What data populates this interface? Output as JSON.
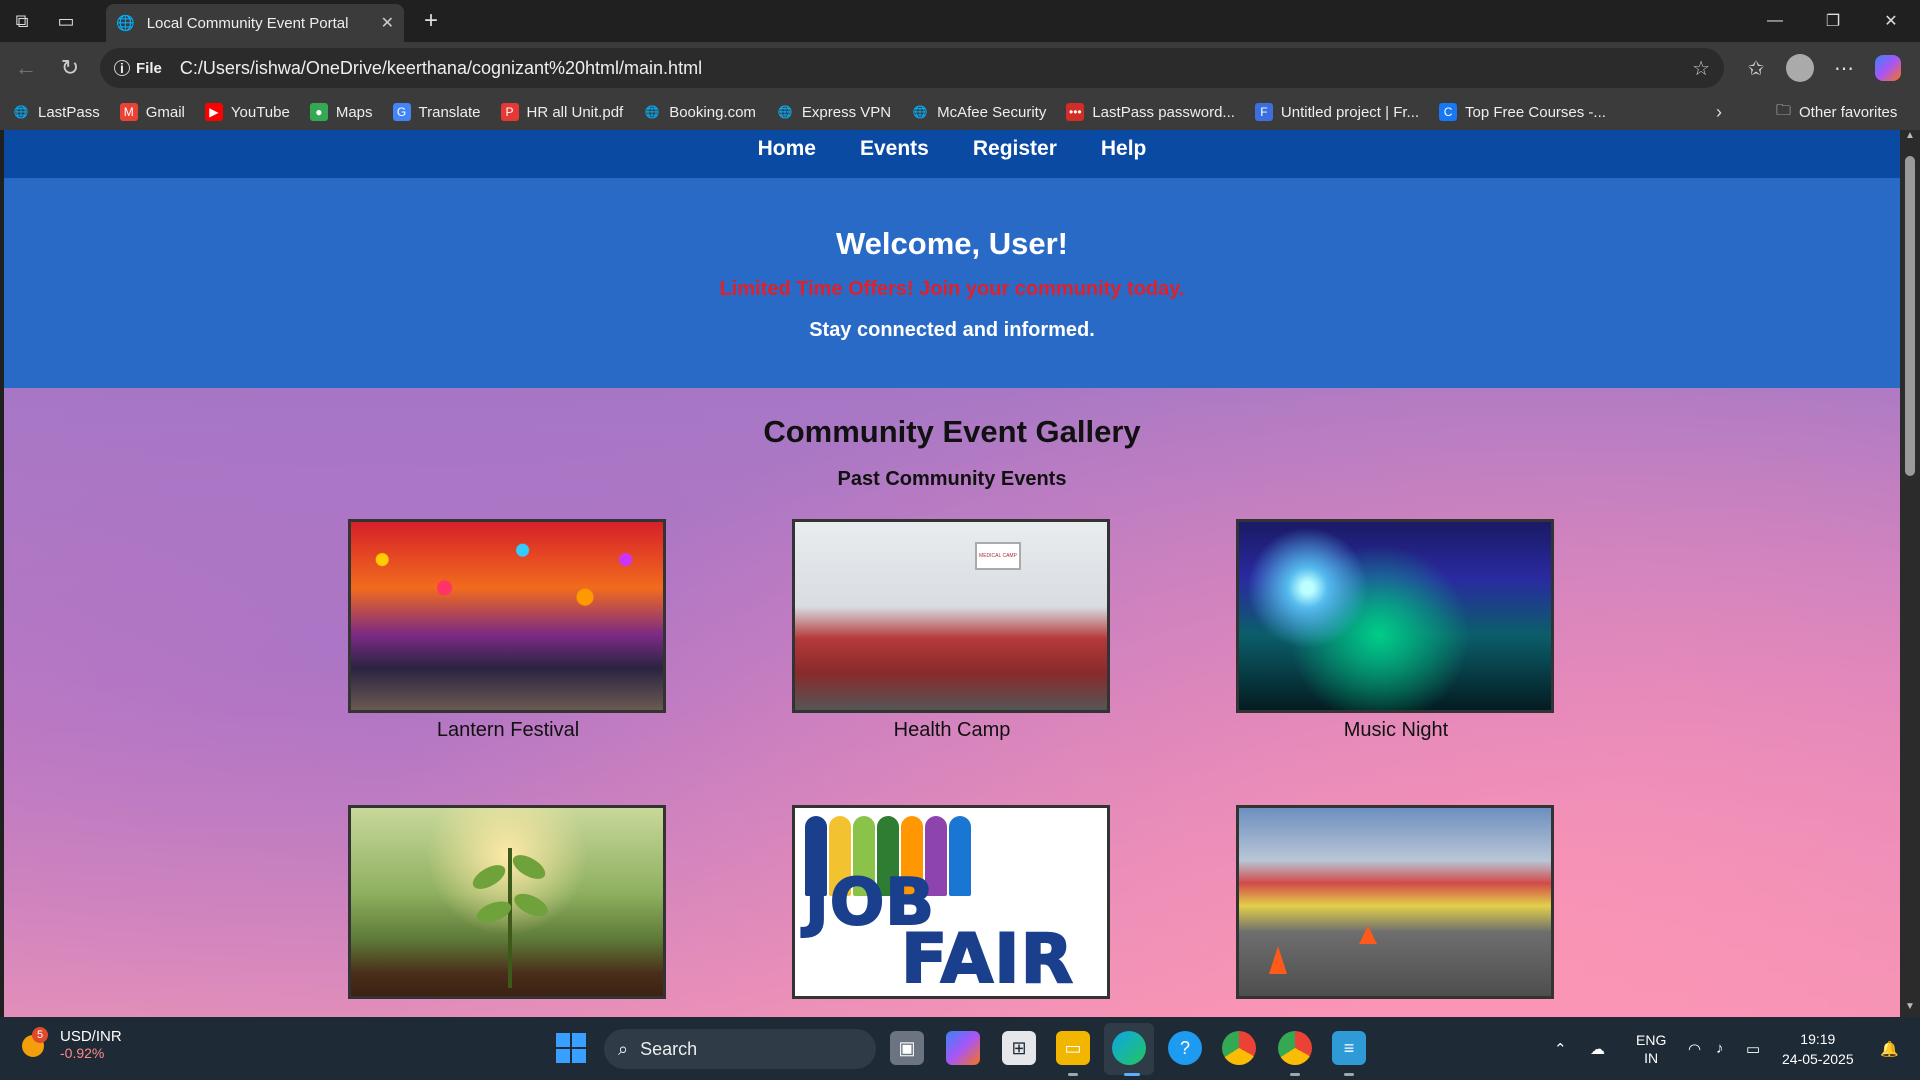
{
  "browser": {
    "tab_title": "Local Community Event Portal",
    "tab_close": "✕",
    "new_tab": "+",
    "address_prefix": "File",
    "url": "C:/Users/ishwa/OneDrive/keerthana/cognizant%20html/main.html"
  },
  "bookmarks": [
    {
      "label": "LastPass",
      "icon": "globe-icon",
      "color": "#cccccc"
    },
    {
      "label": "Gmail",
      "icon": "gmail-icon",
      "color": "#ea4335"
    },
    {
      "label": "YouTube",
      "icon": "youtube-icon",
      "color": "#ff0000"
    },
    {
      "label": "Maps",
      "icon": "maps-icon",
      "color": "#34a853"
    },
    {
      "label": "Translate",
      "icon": "translate-icon",
      "color": "#4285f4"
    },
    {
      "label": "HR all Unit.pdf",
      "icon": "pdf-icon",
      "color": "#e53935"
    },
    {
      "label": "Booking.com",
      "icon": "globe-icon",
      "color": "#cccccc"
    },
    {
      "label": "Express VPN",
      "icon": "globe-icon",
      "color": "#cccccc"
    },
    {
      "label": "McAfee Security",
      "icon": "globe-icon",
      "color": "#cccccc"
    },
    {
      "label": "LastPass password...",
      "icon": "lastpass-icon",
      "color": "#d32d27"
    },
    {
      "label": "Untitled project | Fr...",
      "icon": "document-icon",
      "color": "#3b6fe0"
    },
    {
      "label": "Top Free Courses -...",
      "icon": "course-icon",
      "color": "#1877f2"
    }
  ],
  "bookmarks_other": "Other favorites",
  "site": {
    "nav": [
      "Home",
      "Events",
      "Register",
      "Help"
    ],
    "hero": {
      "title": "Welcome, User!",
      "offer": "Limited Time Offers! Join your community today.",
      "tagline": "Stay connected and informed."
    },
    "gallery": {
      "title": "Community Event Gallery",
      "subtitle": "Past Community Events",
      "items": [
        {
          "caption": "Lantern Festival",
          "image": "lantern-festival-photo"
        },
        {
          "caption": "Health Camp",
          "image": "health-camp-photo"
        },
        {
          "caption": "Music Night",
          "image": "music-night-photo"
        },
        {
          "caption": "",
          "image": "tree-planting-photo"
        },
        {
          "caption": "",
          "image": "job-fair-poster"
        },
        {
          "caption": "",
          "image": "street-fair-photo"
        }
      ],
      "job_fair_text": [
        "JOB",
        "FAIR"
      ],
      "health_board_text": "MEDICAL CAMP"
    }
  },
  "taskbar": {
    "ticker_symbol": "USD/INR",
    "ticker_change": "-0.92%",
    "notification_count": "5",
    "search_placeholder": "Search",
    "lang_top": "ENG",
    "lang_bottom": "IN",
    "time": "19:19",
    "date": "24-05-2025"
  },
  "colors": {
    "nav_bg": "#0b4aa2",
    "hero_bg": "#2a6ac7",
    "offer_red": "#e0202a"
  }
}
